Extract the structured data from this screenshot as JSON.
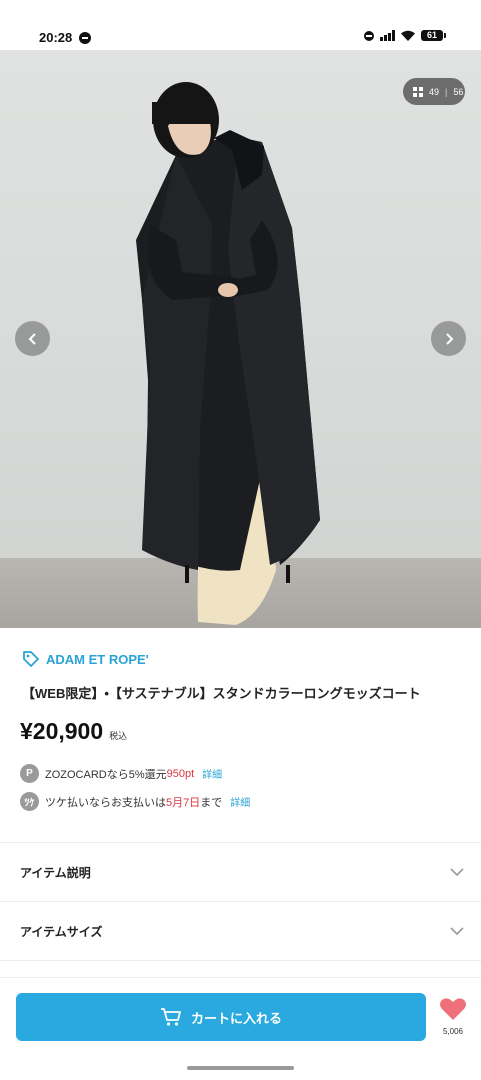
{
  "status_bar": {
    "time": "20:28",
    "battery": "61"
  },
  "gallery": {
    "current": "49",
    "total": "56",
    "separator": "|",
    "icons": {
      "grid": "grid-icon",
      "prev": "chevron-left-icon",
      "next": "chevron-right-icon"
    }
  },
  "product": {
    "brand": "ADAM ET ROPE'",
    "title": "【WEB限定】•【サステナブル】スタンドカラーロングモッズコート",
    "price": "¥20,900",
    "tax_label": "税込"
  },
  "promos": [
    {
      "icon_text": "P",
      "pre": "ZOZOCARDなら5%還元",
      "highlight": "950pt",
      "post": "",
      "link": "詳細"
    },
    {
      "icon_text": "ﾂｹ",
      "pre": "ツケ払いならお支払いは",
      "highlight": "5月7日",
      "post": "まで",
      "link": "詳細"
    }
  ],
  "sections": [
    {
      "label": "アイテム説明"
    },
    {
      "label": "アイテムサイズ"
    }
  ],
  "actions": {
    "cart_label": "カートに入れる",
    "favorite_count": "5,006"
  },
  "colors": {
    "accent": "#29a9df",
    "brand_link": "#2aa3d6",
    "highlight": "#d9363e",
    "favorite": "#f0707a"
  }
}
